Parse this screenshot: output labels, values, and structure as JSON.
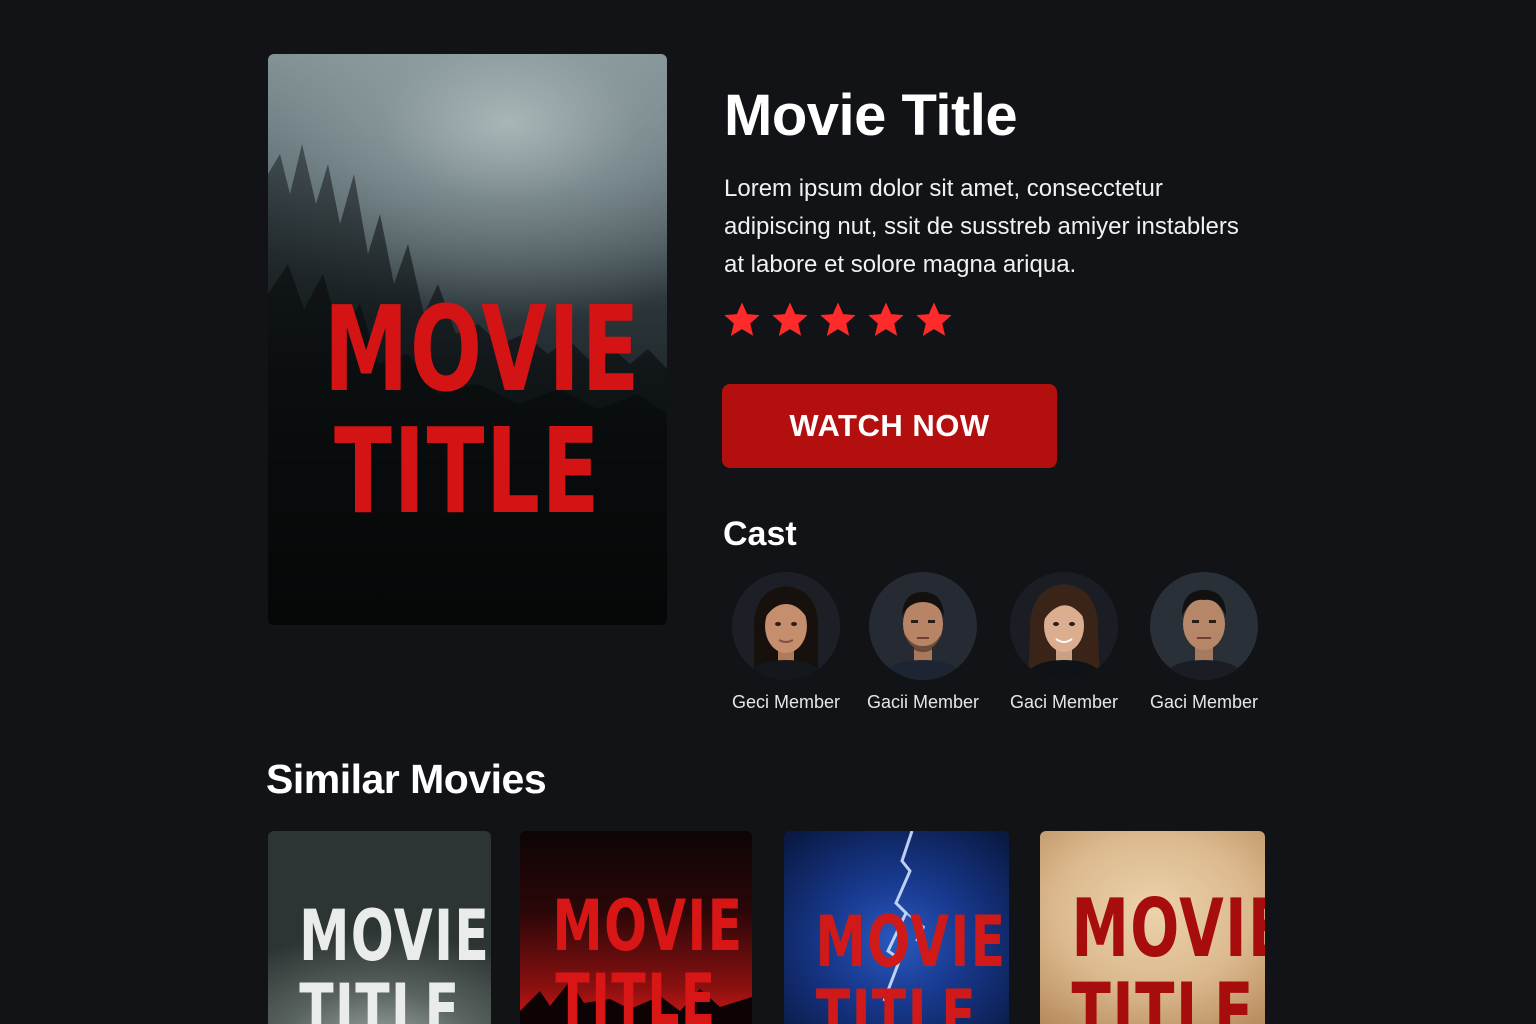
{
  "movie": {
    "title": "Movie Title",
    "poster_text_line1": "MOVIE",
    "poster_text_line2": "TITLE",
    "description": "Lorem ipsum dolor sit amet, consecctetur adipiscing nut, ssit de susstreb amiyer instablers at labore et solore magna ariqua.",
    "rating": {
      "stars": 5,
      "max": 5,
      "color": "#ff2a2a"
    },
    "watch_button_label": "WATCH NOW"
  },
  "cast": {
    "heading": "Cast",
    "members": [
      {
        "name": "Geci Member",
        "icon": "actor-photo-woman"
      },
      {
        "name": "Gacii Member",
        "icon": "actor-photo-man"
      },
      {
        "name": "Gaci Member",
        "icon": "actor-photo-woman"
      },
      {
        "name": "Gaci Member",
        "icon": "actor-photo-man"
      }
    ]
  },
  "similar": {
    "heading": "Similar Movies",
    "movies": [
      {
        "line1": "MOVIE",
        "line2": "TITLE",
        "theme": "grey-fog"
      },
      {
        "line1": "MOVIE",
        "line2": "TITLE",
        "theme": "red-night"
      },
      {
        "line1": "MOVIE",
        "line2": "TITLE",
        "theme": "blue-lightning"
      },
      {
        "line1": "MOVIE",
        "line2": "TITLE",
        "theme": "vintage-paper"
      }
    ]
  },
  "colors": {
    "background": "#111316",
    "accent": "#b30f0f",
    "poster_title": "#d41414",
    "star": "#ff2a2a"
  }
}
